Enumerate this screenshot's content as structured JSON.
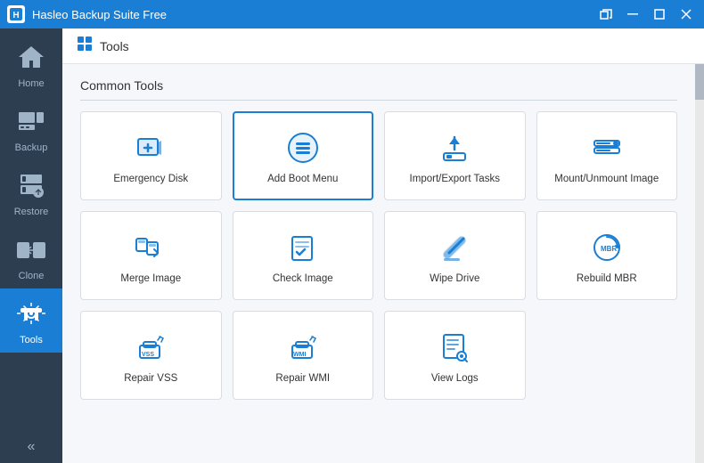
{
  "titlebar": {
    "logo": "H",
    "title": "Hasleo Backup Suite Free",
    "btn_minimize": "—",
    "btn_restore": "❐",
    "btn_close": "✕"
  },
  "sidebar": {
    "items": [
      {
        "id": "home",
        "label": "Home",
        "icon": "🏠"
      },
      {
        "id": "backup",
        "label": "Backup",
        "icon": "💾"
      },
      {
        "id": "restore",
        "label": "Restore",
        "icon": "🗄"
      },
      {
        "id": "clone",
        "label": "Clone",
        "icon": "📋"
      },
      {
        "id": "tools",
        "label": "Tools",
        "icon": "🔧"
      }
    ],
    "collapse_icon": "«"
  },
  "header": {
    "icon": "⊞",
    "title": "Tools"
  },
  "main": {
    "section_title": "Common Tools",
    "tools": [
      {
        "id": "emergency-disk",
        "label": "Emergency Disk",
        "selected": false
      },
      {
        "id": "add-boot-menu",
        "label": "Add Boot Menu",
        "selected": true
      },
      {
        "id": "import-export-tasks",
        "label": "Import/Export Tasks",
        "selected": false
      },
      {
        "id": "mount-unmount-image",
        "label": "Mount/Unmount Image",
        "selected": false
      },
      {
        "id": "merge-image",
        "label": "Merge Image",
        "selected": false
      },
      {
        "id": "check-image",
        "label": "Check Image",
        "selected": false
      },
      {
        "id": "wipe-drive",
        "label": "Wipe Drive",
        "selected": false
      },
      {
        "id": "rebuild-mbr",
        "label": "Rebuild MBR",
        "selected": false
      },
      {
        "id": "repair-vss",
        "label": "Repair VSS",
        "selected": false
      },
      {
        "id": "repair-wmi",
        "label": "Repair WMI",
        "selected": false
      },
      {
        "id": "view-logs",
        "label": "View Logs",
        "selected": false
      }
    ]
  }
}
